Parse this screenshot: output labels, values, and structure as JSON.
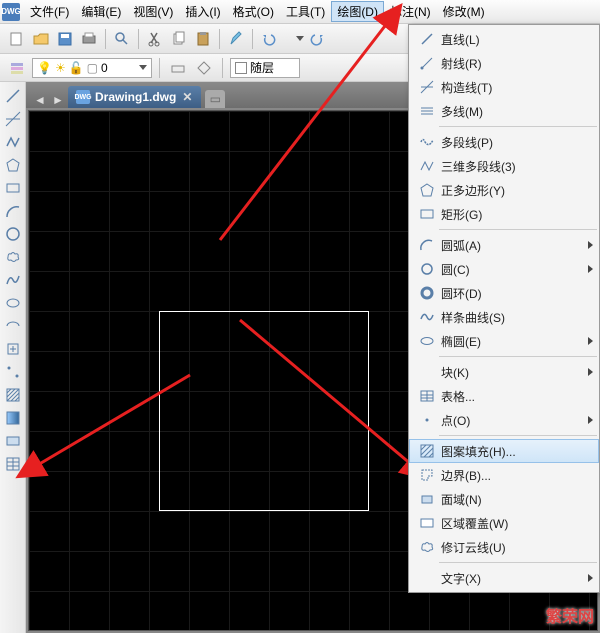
{
  "app_icon": "DWG",
  "menu": [
    "文件(F)",
    "编辑(E)",
    "视图(V)",
    "插入(I)",
    "格式(O)",
    "工具(T)",
    "绘图(D)",
    "标注(N)",
    "修改(M)"
  ],
  "menu_open_index": 6,
  "layer": {
    "name": "0",
    "button_label": "随层"
  },
  "tab": {
    "title": "Drawing1.dwg"
  },
  "dropdown": [
    {
      "icon": "line",
      "label": "直线(L)",
      "sep": false
    },
    {
      "icon": "ray",
      "label": "射线(R)",
      "sep": false
    },
    {
      "icon": "xline",
      "label": "构造线(T)",
      "sep": false
    },
    {
      "icon": "mline",
      "label": "多线(M)",
      "sep": true
    },
    {
      "icon": "pline",
      "label": "多段线(P)",
      "sep": false
    },
    {
      "icon": "3dpoly",
      "label": "三维多段线(3)",
      "sep": false
    },
    {
      "icon": "polygon",
      "label": "正多边形(Y)",
      "sep": false
    },
    {
      "icon": "rect",
      "label": "矩形(G)",
      "sep": true
    },
    {
      "icon": "arc",
      "label": "圆弧(A)",
      "sub": true,
      "sep": false
    },
    {
      "icon": "circle",
      "label": "圆(C)",
      "sub": true,
      "sep": false
    },
    {
      "icon": "donut",
      "label": "圆环(D)",
      "sep": false
    },
    {
      "icon": "spline",
      "label": "样条曲线(S)",
      "sep": false
    },
    {
      "icon": "ellipse",
      "label": "椭圆(E)",
      "sub": true,
      "sep": true
    },
    {
      "icon": "block",
      "label": "块(K)",
      "sub": true,
      "sep": false
    },
    {
      "icon": "table",
      "label": "表格...",
      "sep": false
    },
    {
      "icon": "point",
      "label": "点(O)",
      "sub": true,
      "sep": true
    },
    {
      "icon": "hatch",
      "label": "图案填充(H)...",
      "hl": true,
      "sep": false
    },
    {
      "icon": "boundary",
      "label": "边界(B)...",
      "sep": false
    },
    {
      "icon": "region",
      "label": "面域(N)",
      "sep": false
    },
    {
      "icon": "wipeout",
      "label": "区域覆盖(W)",
      "sep": false
    },
    {
      "icon": "revcloud",
      "label": "修订云线(U)",
      "sep": true
    },
    {
      "icon": "text",
      "label": "文字(X)",
      "sub": true,
      "sep": false
    }
  ],
  "watermark": "繁荣网"
}
